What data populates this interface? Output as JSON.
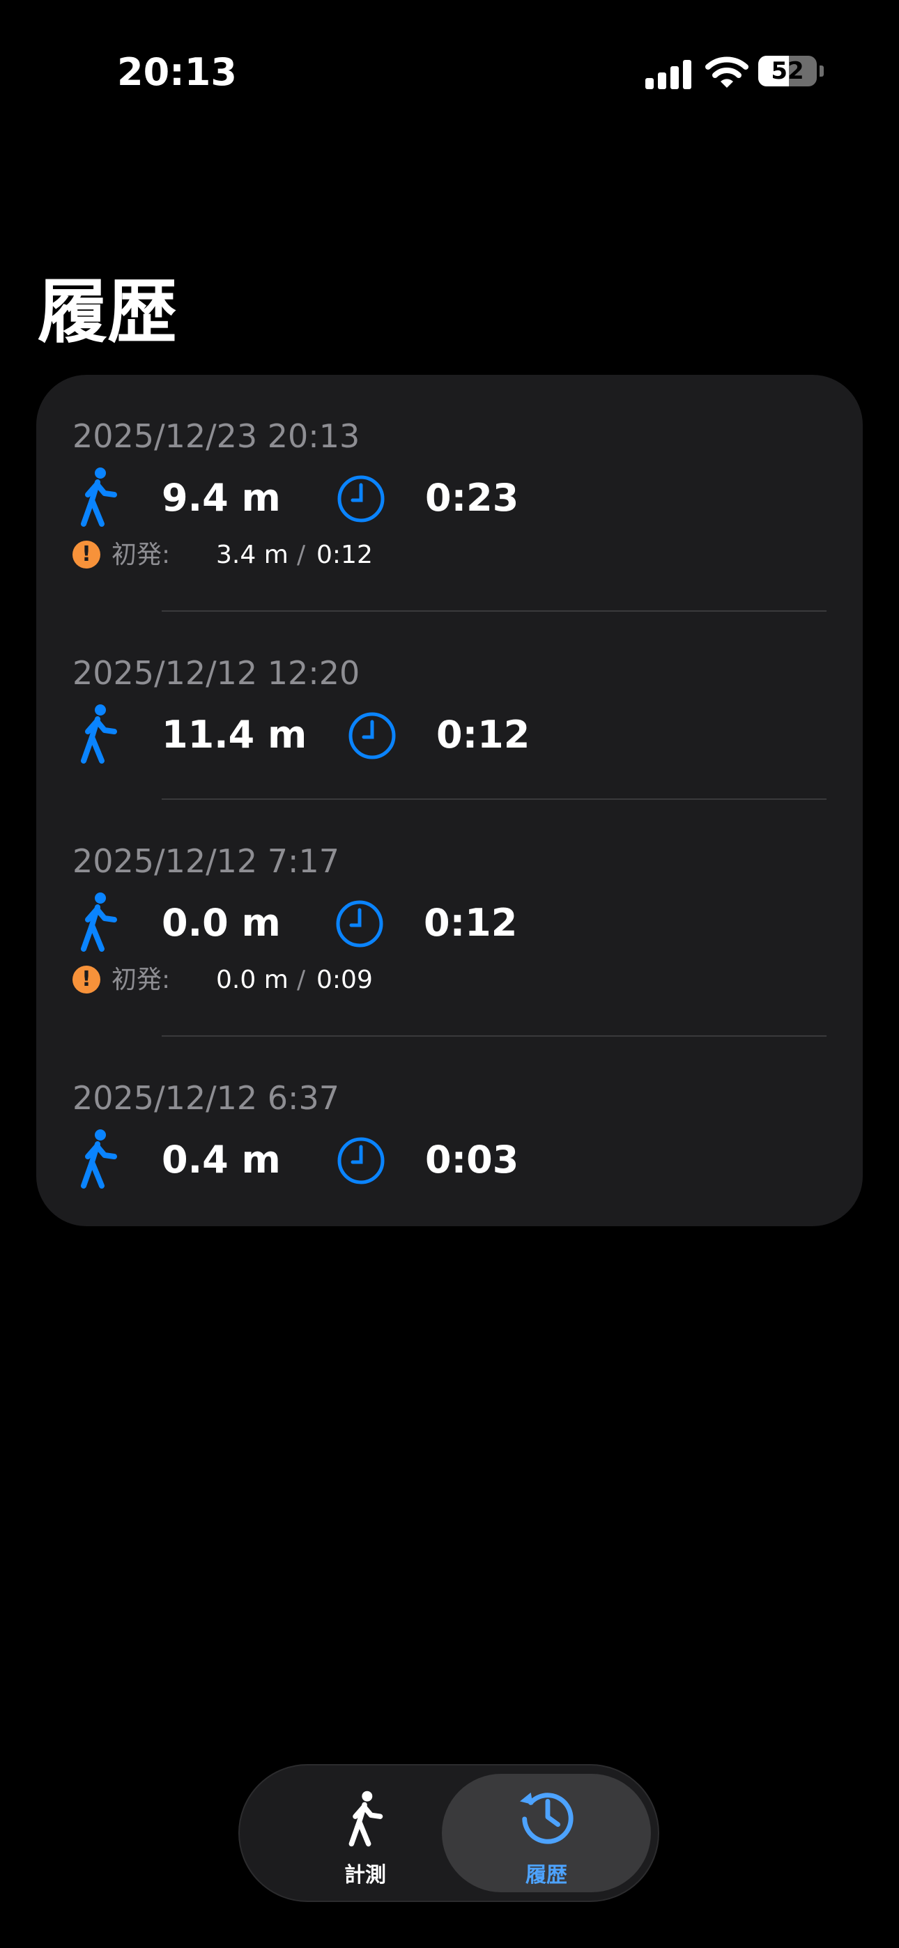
{
  "status_bar": {
    "time": "20:13",
    "battery": "52",
    "battery_level": 0.52
  },
  "page": {
    "title": "履歴"
  },
  "entries": [
    {
      "date": "2025/12/23 20:13",
      "distance": "9.4 m",
      "duration": "0:23",
      "warning": {
        "label": "初発:",
        "distance": "3.4 m",
        "separator": "/",
        "duration": "0:12"
      }
    },
    {
      "date": "2025/12/12 12:20",
      "distance": "11.4 m",
      "duration": "0:12"
    },
    {
      "date": "2025/12/12 7:17",
      "distance": "0.0 m",
      "duration": "0:12",
      "warning": {
        "label": "初発:",
        "distance": "0.0 m",
        "separator": "/",
        "duration": "0:09"
      }
    },
    {
      "date": "2025/12/12 6:37",
      "distance": "0.4 m",
      "duration": "0:03"
    }
  ],
  "icons": {
    "walk": "figure-walk-icon",
    "clock": "clock-icon",
    "warning": "exclamation-circle-icon",
    "history": "clock-arrow-icon"
  },
  "warning_mark": "!",
  "colors": {
    "accent": "#0a84ff",
    "warning": "#f7923a",
    "card": "#1c1c1e",
    "secondary_text": "#8e8e93"
  },
  "tab_bar": {
    "tabs": [
      {
        "label": "計測",
        "selected": false
      },
      {
        "label": "履歴",
        "selected": true
      }
    ]
  }
}
